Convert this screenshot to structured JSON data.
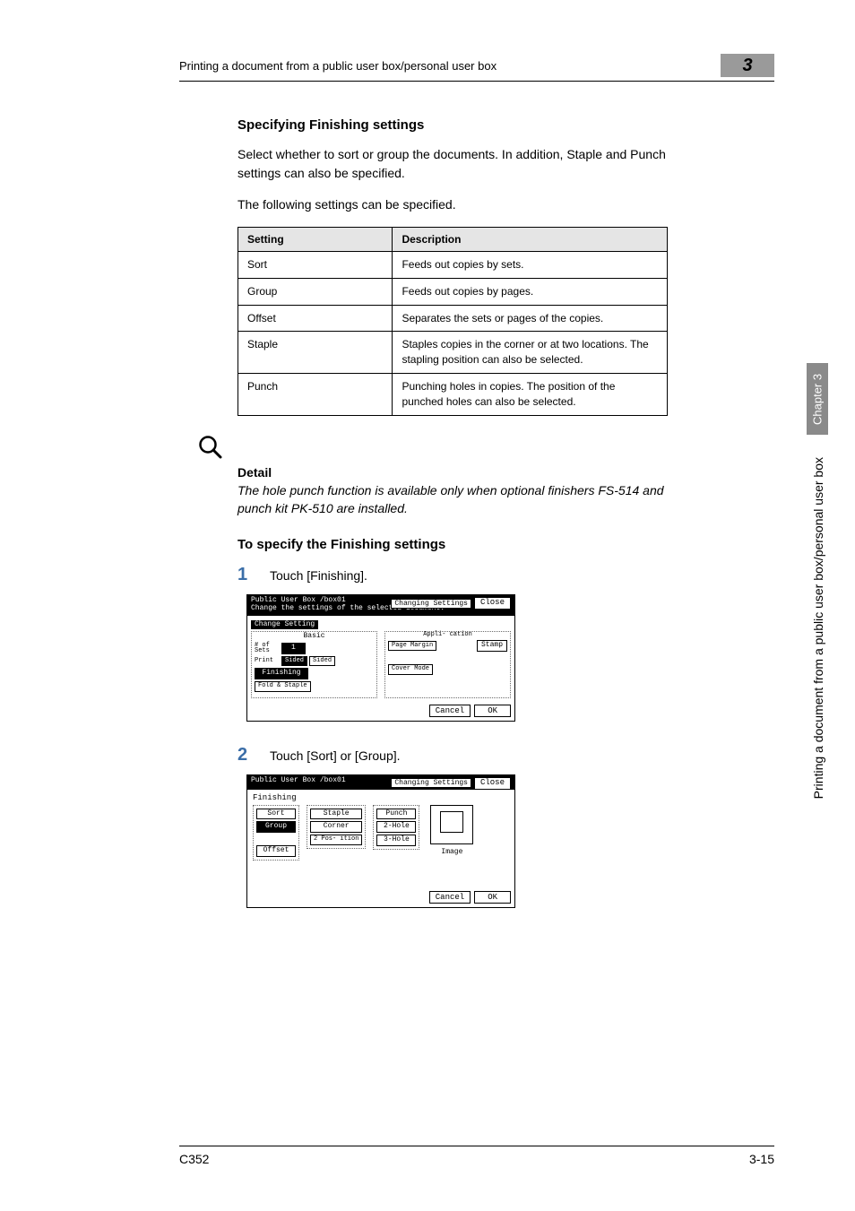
{
  "header": {
    "title": "Printing a document from a public user box/personal user box",
    "chapter_number": "3"
  },
  "section": {
    "title": "Specifying Finishing settings",
    "intro1": "Select whether to sort or group the documents. In addition, Staple and Punch settings can also be specified.",
    "intro2": "The following settings can be specified."
  },
  "table": {
    "col1": "Setting",
    "col2": "Description",
    "rows": [
      {
        "setting": "Sort",
        "desc": "Feeds out copies by sets."
      },
      {
        "setting": "Group",
        "desc": "Feeds out copies by pages."
      },
      {
        "setting": "Offset",
        "desc": "Separates the sets or pages of the copies."
      },
      {
        "setting": "Staple",
        "desc": "Staples copies in the corner or at two locations. The stapling position can also be selected."
      },
      {
        "setting": "Punch",
        "desc": "Punching holes in copies. The position of the punched holes can also be selected."
      }
    ]
  },
  "detail": {
    "label": "Detail",
    "text": "The hole punch function is available only when optional finishers FS-514 and punch kit PK-510 are installed."
  },
  "procedure": {
    "title": "To specify the Finishing settings",
    "step1": {
      "num": "1",
      "text": "Touch [Finishing]."
    },
    "step2": {
      "num": "2",
      "text": "Touch [Sort] or [Group]."
    }
  },
  "panel1": {
    "box_path": "Public User Box  /box01",
    "subtitle": "Change the settings of the selected document.",
    "changing": "Changing Settings",
    "close": "Close",
    "change_setting": "Change Setting",
    "basic_label": "Basic",
    "appli_label": "Appli- cation",
    "sets_label": "# of Sets",
    "sets_value": "1",
    "print_label": "Print",
    "sided1": "Sided",
    "sided2": "Sided",
    "finishing": "Finishing",
    "fold": "Fold & Staple",
    "page_margin": "Page Margin",
    "cover_mode": "Cover Mode",
    "stamp": "Stamp",
    "cancel": "Cancel",
    "ok": "OK"
  },
  "panel2": {
    "box_path": "Public User Box  /box01",
    "changing": "Changing Settings",
    "close": "Close",
    "finishing_title": "Finishing",
    "sort": "Sort",
    "group": "Group",
    "offset": "Offset",
    "staple": "Staple",
    "corner": "Corner",
    "twopos": "2 Pos- ition",
    "punch": "Punch",
    "hole2": "2-Hole",
    "hole3": "3-Hole",
    "image": "Image",
    "cancel": "Cancel",
    "ok": "OK"
  },
  "sidebar": {
    "chapter_label": "Chapter 3",
    "side_text": "Printing a document from a public user box/personal user box"
  },
  "footer": {
    "model": "C352",
    "page": "3-15"
  }
}
